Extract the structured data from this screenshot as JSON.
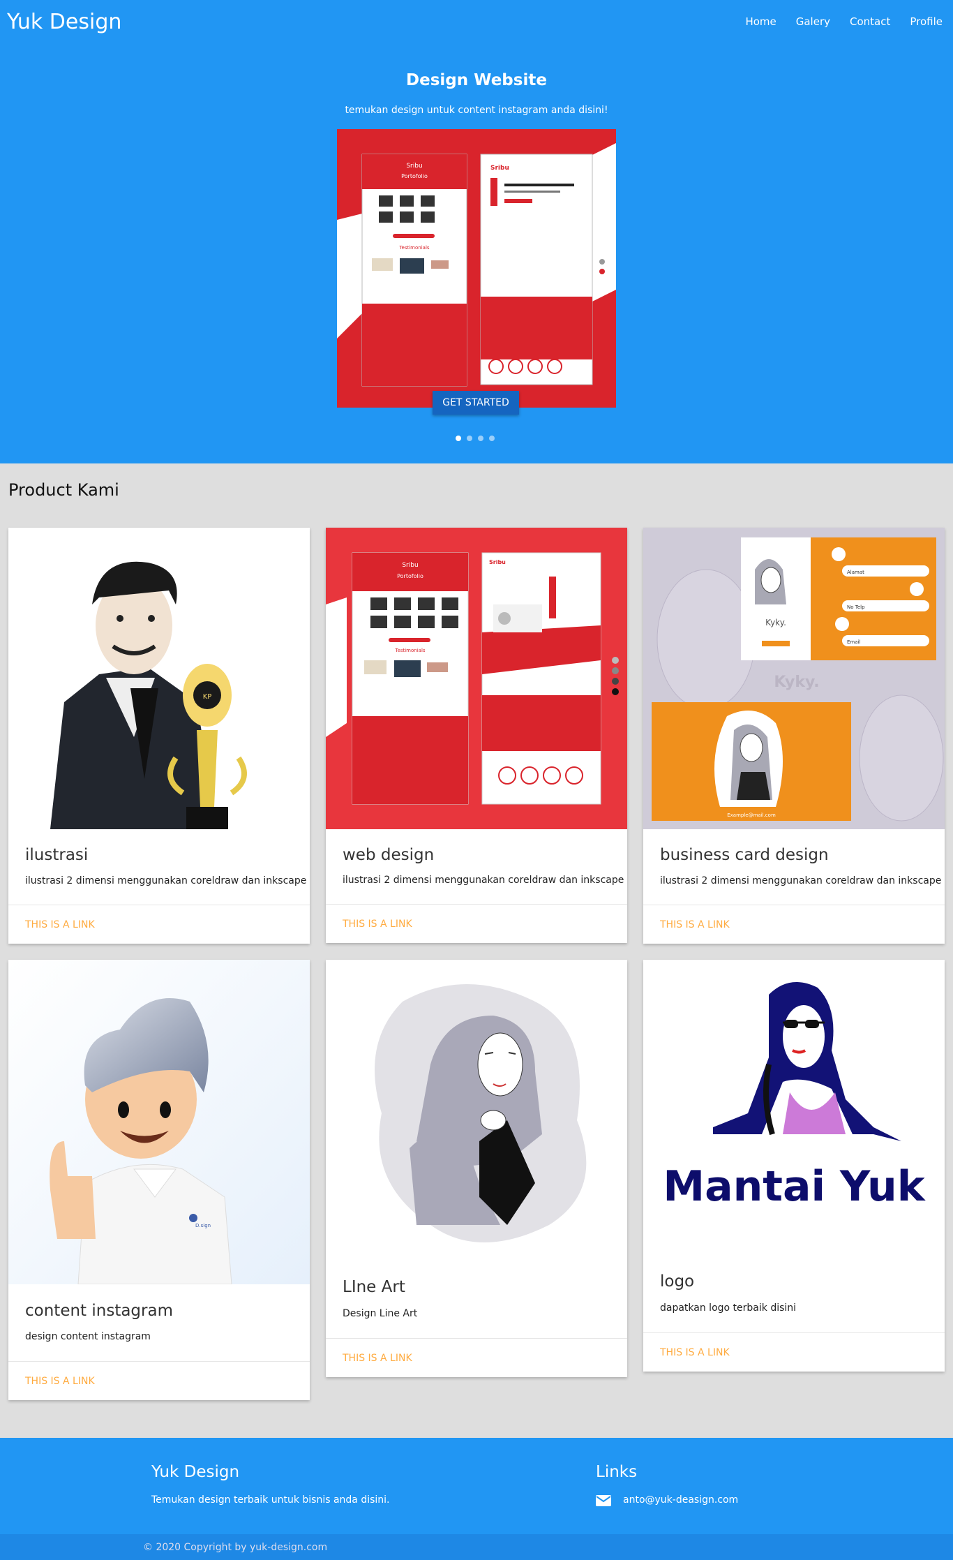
{
  "nav": {
    "brand": "Yuk Design",
    "links": [
      "Home",
      "Galery",
      "Contact",
      "Profile"
    ]
  },
  "hero": {
    "title": "Design Website",
    "subtitle": "temukan design untuk content instagram anda disini!",
    "cta": "GET STARTED",
    "slides": 4,
    "active_slide": 0
  },
  "products": {
    "title": "Product Kami",
    "cards": [
      {
        "title": "ilustrasi",
        "desc": "ilustrasi 2 dimensi menggunakan coreldraw dan inkscape",
        "link": "This is a link",
        "icon": "man-with-trophy-illustration"
      },
      {
        "title": "web design",
        "desc": "ilustrasi 2 dimensi menggunakan coreldraw dan inkscape",
        "link": "This is a link",
        "icon": "landing-page-mockup"
      },
      {
        "title": "business card design",
        "desc": "ilustrasi 2 dimensi menggunakan coreldraw dan inkscape",
        "link": "This is a link",
        "icon": "business-card-mockup"
      },
      {
        "title": "content instagram",
        "desc": "design content instagram",
        "link": "This is a link",
        "icon": "thumbs-up-character"
      },
      {
        "title": "LIne Art",
        "desc": "Design Line Art",
        "link": "This is a link",
        "icon": "hijab-line-art"
      },
      {
        "title": "logo",
        "desc": "dapatkan logo terbaik disini",
        "link": "This is a link",
        "icon": "mantai-yuk-logo"
      }
    ]
  },
  "footer": {
    "brand": "Yuk Design",
    "tagline": "Temukan design terbaik untuk bisnis anda disini.",
    "links_title": "Links",
    "email": "anto@yuk-deasign.com",
    "copyright": "© 2020 Copyright by yuk-design.com"
  },
  "colors": {
    "primary": "#2196f3",
    "accent_link": "#ffab40",
    "button": "#1565c0",
    "red": "#d9242c",
    "orange": "#f0901c"
  }
}
